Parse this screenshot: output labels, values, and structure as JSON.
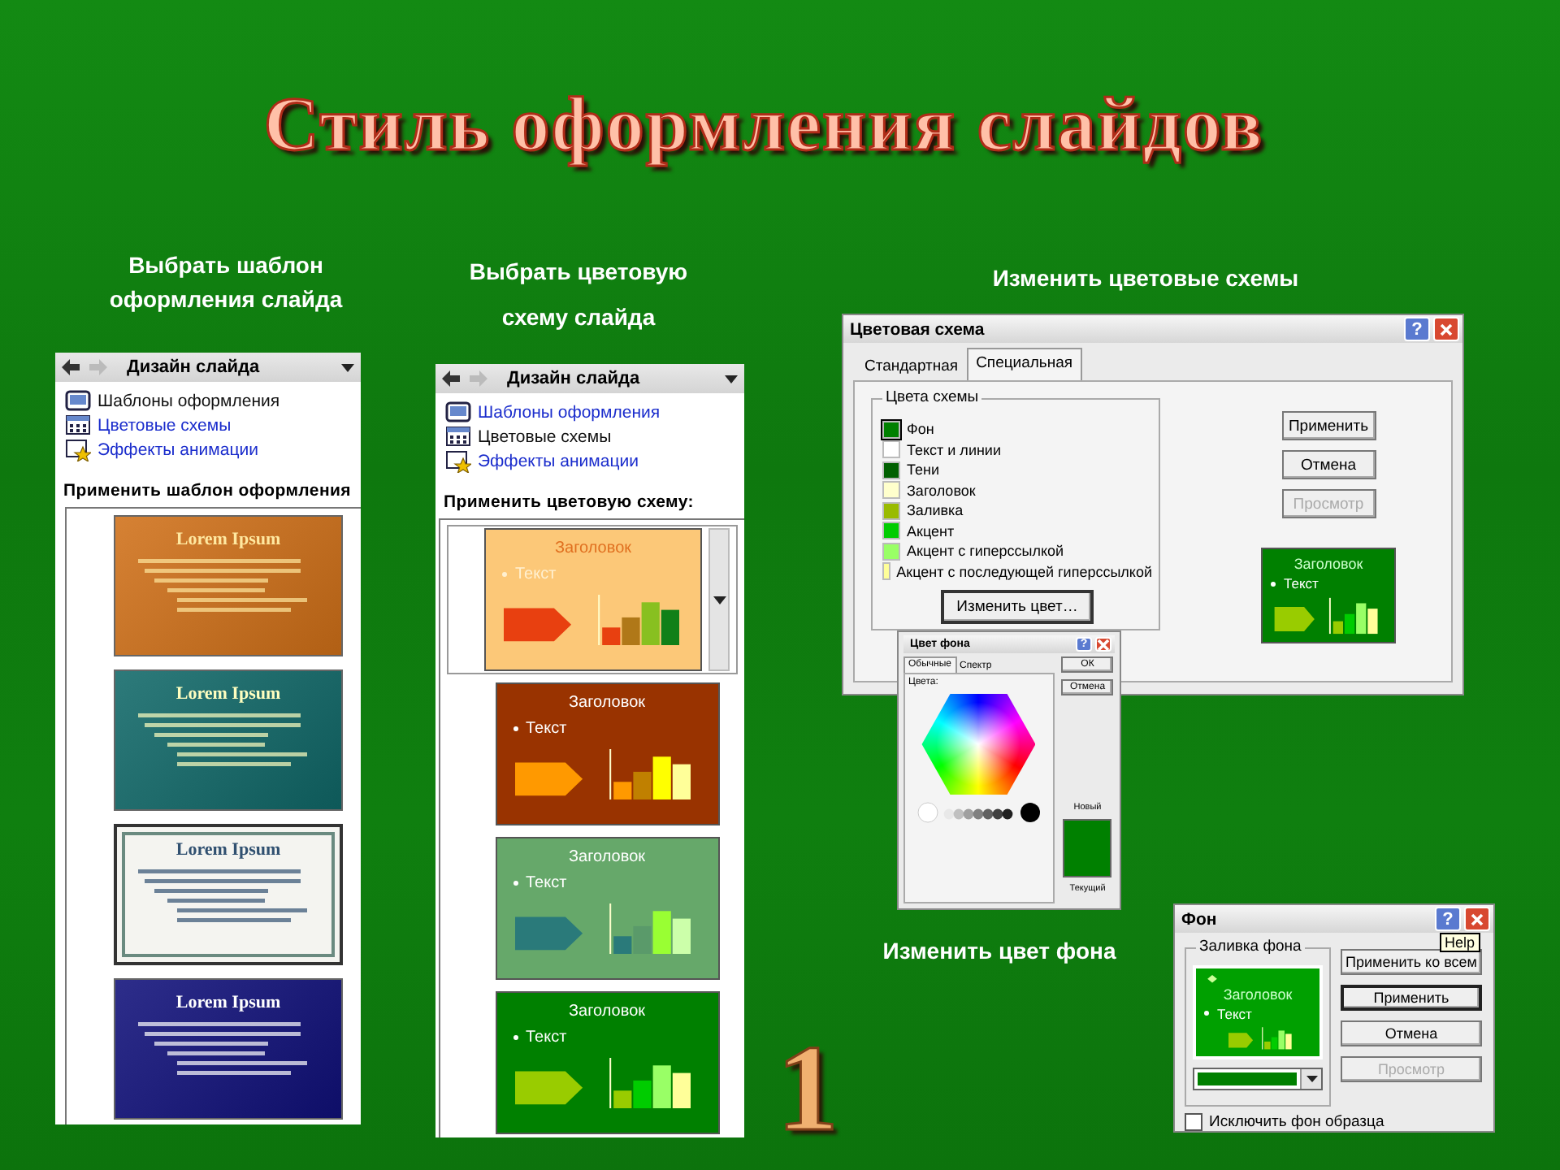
{
  "slide": {
    "title": "Стиль оформления слайдов",
    "page_number": "1"
  },
  "template_pane": {
    "caption": "Выбрать шаблон оформления слайда",
    "header": "Дизайн слайда",
    "links": [
      {
        "label": "Шаблоны оформления",
        "kind": "templates",
        "selected": true
      },
      {
        "label": "Цветовые схемы",
        "kind": "schemes",
        "selected": false
      },
      {
        "label": "Эффекты анимации",
        "kind": "effects",
        "selected": false
      }
    ],
    "section": "Применить шаблон оформления",
    "templates": [
      {
        "title": "Lorem Ipsum",
        "kind": "warm",
        "color": "#d07018"
      },
      {
        "title": "Lorem Ipsum",
        "kind": "teal",
        "color": "#106868"
      },
      {
        "title": "Lorem Ipsum",
        "kind": "framed",
        "color": "#f4f4f0"
      },
      {
        "title": "Lorem Ipsum",
        "kind": "navy",
        "color": "#10107a"
      }
    ]
  },
  "scheme_pane": {
    "caption": "Выбрать цветовую схему слайда",
    "header": "Дизайн слайда",
    "links": [
      {
        "label": "Шаблоны оформления",
        "kind": "templates",
        "selected": false
      },
      {
        "label": "Цветовые схемы",
        "kind": "schemes",
        "selected": true
      },
      {
        "label": "Эффекты анимации",
        "kind": "effects",
        "selected": false
      }
    ],
    "section": "Применить цветовую схему:",
    "schemes": [
      {
        "title": "Заголовок",
        "bullet": "Текст",
        "selected": true,
        "kind": "warm",
        "color": "#fcc878",
        "arrow": {
          "color": "#e84010"
        },
        "bars": [
          {
            "color": "#e84010"
          },
          {
            "color": "#b07818"
          },
          {
            "color": "#88c020"
          },
          {
            "color": "#108018"
          }
        ]
      },
      {
        "title": "Заголовок",
        "bullet": "Текст",
        "selected": false,
        "kind": "plain",
        "color": "#993300",
        "arrow": {
          "color": "#ff9900"
        },
        "bars": [
          {
            "color": "#ff9900"
          },
          {
            "color": "#c08000"
          },
          {
            "color": "#ffff00"
          },
          {
            "color": "#ffff99"
          }
        ]
      },
      {
        "title": "Заголовок",
        "bullet": "Текст",
        "selected": false,
        "kind": "plain",
        "color": "#66a86a",
        "arrow": {
          "color": "#2a7a7a"
        },
        "bars": [
          {
            "color": "#2a7a7a"
          },
          {
            "color": "#5a9a6a"
          },
          {
            "color": "#99ff33"
          },
          {
            "color": "#ccffaa"
          }
        ]
      },
      {
        "title": "Заголовок",
        "bullet": "Текст",
        "selected": false,
        "kind": "plain",
        "color": "#008000",
        "arrow": {
          "color": "#99cc00"
        },
        "bars": [
          {
            "color": "#99cc00"
          },
          {
            "color": "#00cc00"
          },
          {
            "color": "#99ff66"
          },
          {
            "color": "#ffff99"
          }
        ]
      }
    ]
  },
  "color_dialog": {
    "caption": "Изменить цветовые схемы",
    "title": "Цветовая схема",
    "help_button": "?",
    "tabs": [
      {
        "label": "Стандартная",
        "selected": false
      },
      {
        "label": "Специальная",
        "selected": true
      }
    ],
    "group": "Цвета схемы",
    "colors": [
      {
        "label": "Фон",
        "color": "#008000",
        "selected": true
      },
      {
        "label": "Текст и линии",
        "color": "#ffffff",
        "selected": false
      },
      {
        "label": "Тени",
        "color": "#006000",
        "selected": false
      },
      {
        "label": "Заголовок",
        "color": "#ffffcc",
        "selected": false
      },
      {
        "label": "Заливка",
        "color": "#99bb00",
        "selected": false
      },
      {
        "label": "Акцент",
        "color": "#00cc00",
        "selected": false
      },
      {
        "label": "Акцент с гиперссылкой",
        "color": "#99ff66",
        "selected": false
      },
      {
        "label": "Акцент с последующей гиперссылкой",
        "color": "#ffff99",
        "selected": false
      }
    ],
    "change_button": "Изменить цвет…",
    "buttons": [
      {
        "label": "Применить",
        "disabled": false
      },
      {
        "label": "Отмена",
        "disabled": false
      },
      {
        "label": "Просмотр",
        "disabled": true
      }
    ],
    "preview": {
      "title": "Заголовок",
      "bullet": "Текст",
      "kind": "bright",
      "color": "#008000",
      "arrow": {
        "color": "#99cc00"
      },
      "bars": [
        {
          "color": "#99cc00"
        },
        {
          "color": "#00cc00"
        },
        {
          "color": "#99ff66"
        },
        {
          "color": "#ffff99"
        }
      ]
    }
  },
  "picker_dialog": {
    "title": "Цвет фона",
    "help_button": "?",
    "tabs": [
      {
        "label": "Обычные",
        "selected": true
      },
      {
        "label": "Спектр",
        "selected": false
      }
    ],
    "label": "Цвета:",
    "buttons": [
      "ОК",
      "Отмена"
    ],
    "new_label": "Новый",
    "current_label": "Текущий",
    "color": "#008000"
  },
  "background_dialog": {
    "caption": "Изменить цвет фона",
    "title": "Фон",
    "help_button": "?",
    "tooltip": "Help",
    "group": "Заливка фона",
    "preview": {
      "title": "Заголовок",
      "bullet": "Текст",
      "kind": "bright",
      "color": "#00a000",
      "arrow": {
        "color": "#99cc00"
      },
      "bars": [
        {
          "color": "#99cc00"
        },
        {
          "color": "#00cc00"
        },
        {
          "color": "#99ff66"
        },
        {
          "color": "#ffff99"
        }
      ]
    },
    "fill": {
      "color": "#008000"
    },
    "buttons": [
      {
        "label": "Применить ко всем",
        "disabled": false,
        "default": false
      },
      {
        "label": "Применить",
        "disabled": false,
        "default": true
      },
      {
        "label": "Отмена",
        "disabled": false,
        "default": false
      },
      {
        "label": "Просмотр",
        "disabled": true,
        "default": false
      }
    ],
    "checkbox": {
      "label": "Исключить фон образца",
      "checked": false
    }
  }
}
